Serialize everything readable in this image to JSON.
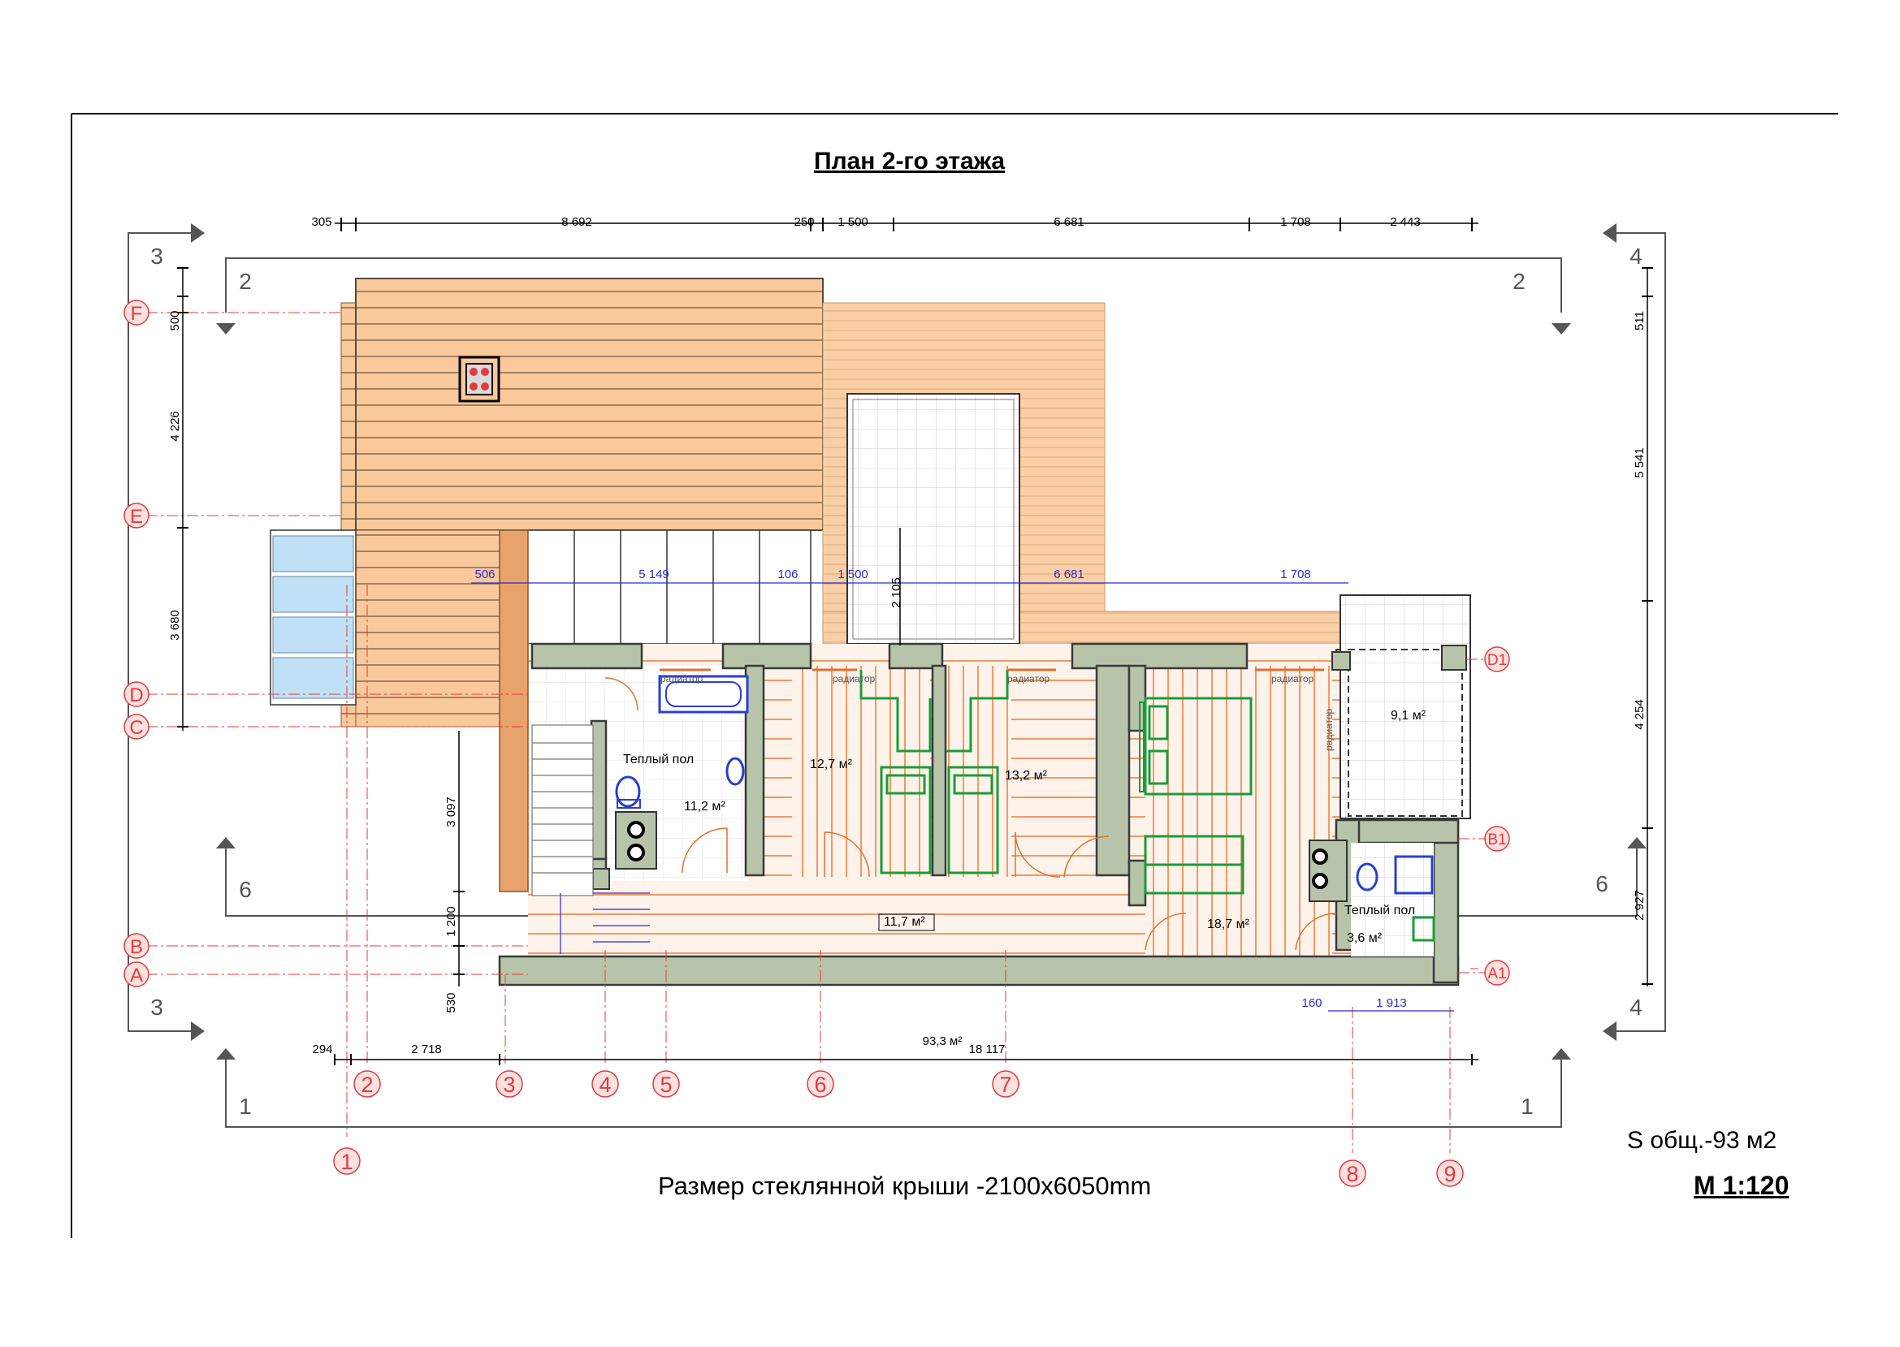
{
  "title": "План 2-го этажа",
  "area_total": "S общ.-93 м2",
  "scale": "М 1:120",
  "glass_roof_note": "Размер стеклянной крыши -2100x6050mm",
  "colors": {
    "roof": "#f9c89b",
    "roof_line": "#8a6a4a",
    "wall": "#b7c4a9",
    "wall_stroke": "#3a3a3a",
    "floor_line": "#f07a3a",
    "grid_axis": "#e03c3c",
    "furniture": "#1a9c3a",
    "plumbing": "#2a3fd0",
    "glass": "#bfe0f5",
    "dim_blue": "#2a2ad0"
  },
  "top_dims": [
    "305",
    "8 692",
    "250",
    "1 500",
    "6 681",
    "1 708",
    "2 443"
  ],
  "inner_dims": [
    "506",
    "5 149",
    "106",
    "1 500",
    "6 681",
    "1 708"
  ],
  "left_dims": [
    "500",
    "4 226",
    "3 680",
    "3 097",
    "1 200",
    "530"
  ],
  "right_dims": [
    "511",
    "5 541",
    "4 254",
    "2 927"
  ],
  "bottom_dims": [
    "294",
    "2 718",
    "18 117"
  ],
  "bottom_right_dims": [
    "160",
    "1 913"
  ],
  "glass_roof_dim": "2 105",
  "row_axes": [
    "F",
    "E",
    "D",
    "C",
    "B",
    "A"
  ],
  "row_axes_right": [
    "D1",
    "B1",
    "A1"
  ],
  "col_axes": [
    "1",
    "2",
    "3",
    "4",
    "5",
    "6",
    "7",
    "8",
    "9"
  ],
  "section_marks": {
    "s1": "1",
    "s2": "2",
    "s3": "3",
    "s4": "4",
    "s6": "6"
  },
  "rooms": {
    "bath1_label": "Теплый пол",
    "bath1_area": "11,2 м²",
    "room1_area": "12,7 м²",
    "room2_area": "13,2 м²",
    "hall_area": "11,7 м²",
    "room3_area": "18,7 м²",
    "balcony_area": "9,1 м²",
    "bath2_label": "Теплый пол",
    "bath2_area": "3,6 м²",
    "total_area": "93,3 м²"
  },
  "radiator_label": "радиатор"
}
